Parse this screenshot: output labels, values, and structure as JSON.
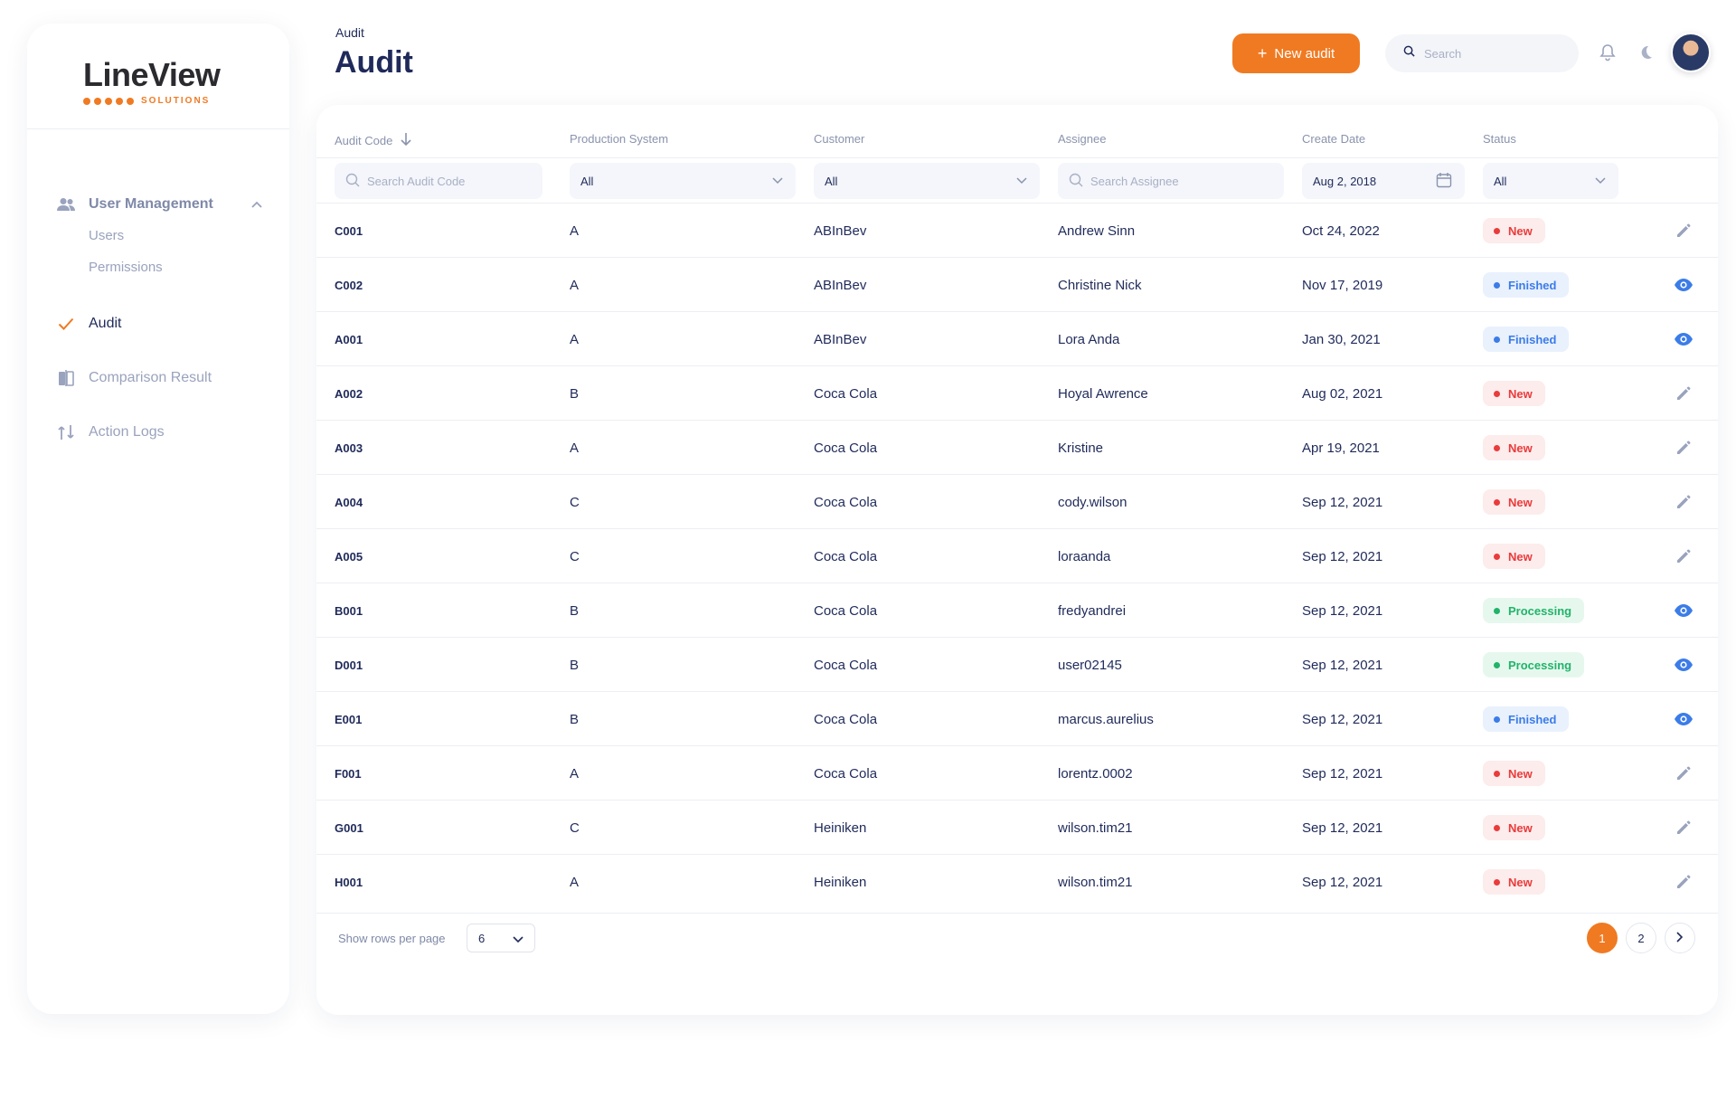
{
  "sidebar": {
    "logo": {
      "word": "LineView",
      "sub": "SOLUTIONS"
    },
    "items": [
      {
        "label": "User Management",
        "icon": "users-icon"
      },
      {
        "label": "Users"
      },
      {
        "label": "Permissions"
      },
      {
        "label": "Audit",
        "icon": "check-icon"
      },
      {
        "label": "Comparison Result",
        "icon": "comparison-icon"
      },
      {
        "label": "Action Logs",
        "icon": "action-logs-icon"
      }
    ]
  },
  "header": {
    "breadcrumb": "Audit",
    "title": "Audit",
    "new_button": "New audit",
    "search_placeholder": "Search"
  },
  "table": {
    "columns": [
      "Audit Code",
      "Production System",
      "Customer",
      "Assignee",
      "Create Date",
      "Status"
    ],
    "filters": {
      "code_placeholder": "Search Audit Code",
      "production_system": "All",
      "customer": "All",
      "assignee_placeholder": "Search Assignee",
      "create_date": "Aug 2, 2018",
      "status": "All"
    },
    "rows": [
      {
        "code": "C001",
        "system": "A",
        "customer": "ABInBev",
        "assignee": "Andrew Sinn",
        "date": "Oct 24, 2022",
        "status": "New",
        "action": "edit"
      },
      {
        "code": "C002",
        "system": "A",
        "customer": "ABInBev",
        "assignee": "Christine Nick",
        "date": "Nov 17, 2019",
        "status": "Finished",
        "action": "view"
      },
      {
        "code": "A001",
        "system": "A",
        "customer": "ABInBev",
        "assignee": "Lora Anda",
        "date": "Jan 30, 2021",
        "status": "Finished",
        "action": "view"
      },
      {
        "code": "A002",
        "system": "B",
        "customer": "Coca Cola",
        "assignee": "Hoyal Awrence",
        "date": "Aug 02, 2021",
        "status": "New",
        "action": "edit"
      },
      {
        "code": "A003",
        "system": "A",
        "customer": "Coca Cola",
        "assignee": "Kristine",
        "date": "Apr 19, 2021",
        "status": "New",
        "action": "edit"
      },
      {
        "code": "A004",
        "system": "C",
        "customer": "Coca Cola",
        "assignee": "cody.wilson",
        "date": "Sep 12, 2021",
        "status": "New",
        "action": "edit"
      },
      {
        "code": "A005",
        "system": "C",
        "customer": "Coca Cola",
        "assignee": "loraanda",
        "date": "Sep 12, 2021",
        "status": "New",
        "action": "edit"
      },
      {
        "code": "B001",
        "system": "B",
        "customer": "Coca Cola",
        "assignee": "fredyandrei",
        "date": "Sep 12, 2021",
        "status": "Processing",
        "action": "view"
      },
      {
        "code": "D001",
        "system": "B",
        "customer": "Coca Cola",
        "assignee": "user02145",
        "date": "Sep 12, 2021",
        "status": "Processing",
        "action": "view"
      },
      {
        "code": "E001",
        "system": "B",
        "customer": "Coca Cola",
        "assignee": "marcus.aurelius",
        "date": "Sep 12, 2021",
        "status": "Finished",
        "action": "view"
      },
      {
        "code": "F001",
        "system": "A",
        "customer": "Coca Cola",
        "assignee": "lorentz.0002",
        "date": "Sep 12, 2021",
        "status": "New",
        "action": "edit"
      },
      {
        "code": "G001",
        "system": "C",
        "customer": "Heiniken",
        "assignee": "wilson.tim21",
        "date": "Sep 12, 2021",
        "status": "New",
        "action": "edit"
      },
      {
        "code": "H001",
        "system": "A",
        "customer": "Heiniken",
        "assignee": "wilson.tim21",
        "date": "Sep 12, 2021",
        "status": "New",
        "action": "edit"
      }
    ]
  },
  "footer": {
    "rows_label": "Show rows per page",
    "rows_value": "6",
    "pages": [
      "1",
      "2"
    ],
    "current_page": "1"
  },
  "colors": {
    "accent": "#f07a22",
    "text": "#1f2a5a",
    "new": "#ea3b3b",
    "finished": "#3b7ce8",
    "processing": "#22b36a"
  }
}
